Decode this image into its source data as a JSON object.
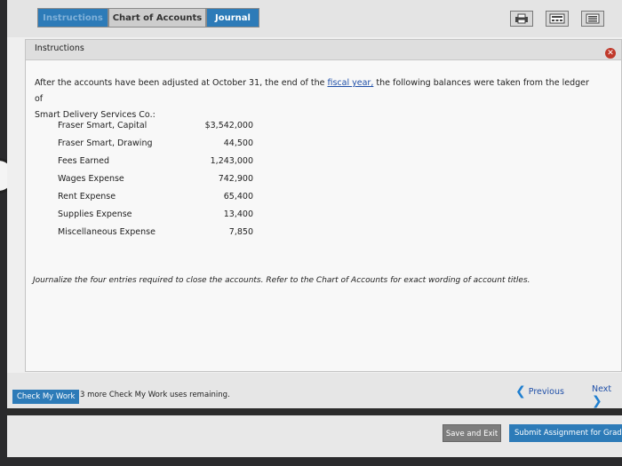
{
  "tabs": {
    "instructions": "Instructions",
    "chart_of_accounts": "Chart of Accounts",
    "journal": "Journal"
  },
  "toolbar": {
    "icons": [
      "print-icon",
      "calculator-icon",
      "list-icon"
    ]
  },
  "panel": {
    "title": "Instructions",
    "intro_before_link": "After the accounts have been adjusted at October 31, the end of the ",
    "intro_link": "fiscal year,",
    "intro_after_link": " the following balances were taken from the ledger of",
    "intro_line2": "Smart Delivery Services Co.:",
    "ledger": [
      {
        "account": "Fraser Smart, Capital",
        "amount": "$3,542,000"
      },
      {
        "account": "Fraser Smart, Drawing",
        "amount": "44,500"
      },
      {
        "account": "Fees Earned",
        "amount": "1,243,000"
      },
      {
        "account": "Wages Expense",
        "amount": "742,900"
      },
      {
        "account": "Rent Expense",
        "amount": "65,400"
      },
      {
        "account": "Supplies Expense",
        "amount": "13,400"
      },
      {
        "account": "Miscellaneous Expense",
        "amount": "7,850"
      }
    ],
    "task": "Journalize the four entries required to close the accounts. Refer to the Chart of Accounts for exact wording of account titles."
  },
  "bottom": {
    "check_my_work": "Check My Work",
    "remaining": "3 more Check My Work uses remaining.",
    "previous": "Previous",
    "next": "Next"
  },
  "footer": {
    "save_exit": "Save and Exit",
    "submit": "Submit Assignment for Grading"
  },
  "colors": {
    "accent": "#2d7bb8",
    "close": "#c0392b"
  }
}
